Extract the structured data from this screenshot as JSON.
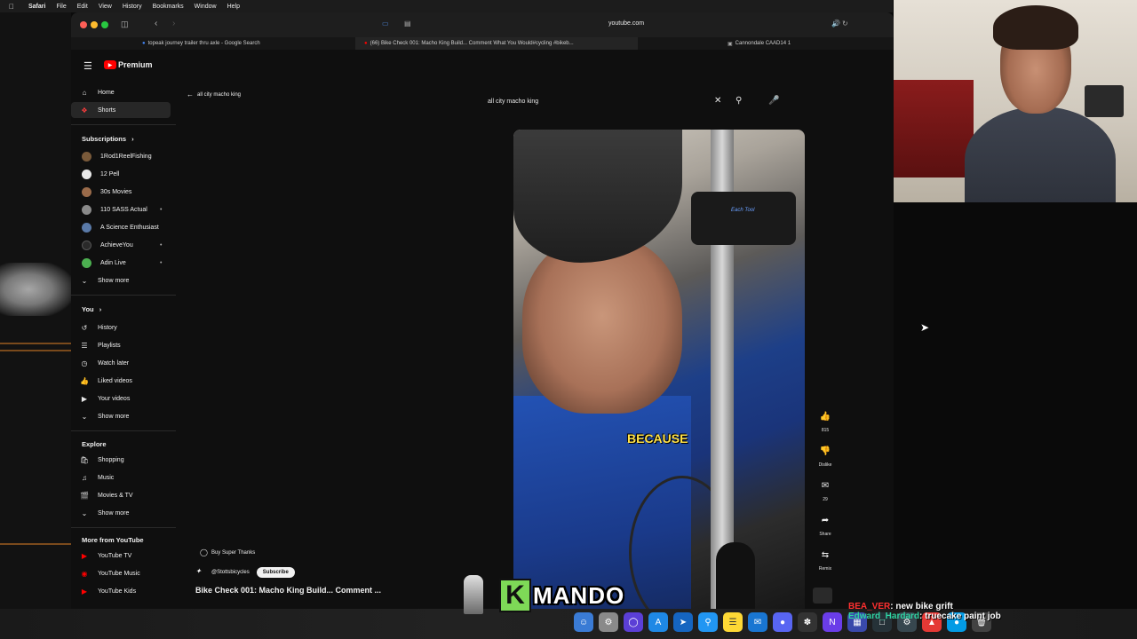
{
  "menubar": {
    "app": "Safari",
    "items": [
      "File",
      "Edit",
      "View",
      "History",
      "Bookmarks",
      "Window",
      "Help"
    ]
  },
  "browser": {
    "url": "youtube.com",
    "tabs": [
      {
        "title": "topeak journey trailer thru axle - Google Search",
        "active": false
      },
      {
        "title": "(66) Bike Check 001: Macho King Build... Comment What You Would#cycling #bikeb...",
        "active": true
      },
      {
        "title": "Cannondale CAAD14 1",
        "active": false
      }
    ]
  },
  "youtube": {
    "logo": "Premium",
    "search_query": "all city macho king",
    "back_label": "all city macho king",
    "sidebar": {
      "main": [
        {
          "label": "Home",
          "icon": "home-icon",
          "active": false
        },
        {
          "label": "Shorts",
          "icon": "shorts-icon",
          "active": true
        }
      ],
      "subscriptions_heading": "Subscriptions",
      "subscriptions": [
        {
          "label": "1Rod1ReelFishing",
          "color": "#7a5a3a",
          "dot": false
        },
        {
          "label": "12 Pell",
          "color": "#e8e8e8",
          "dot": false
        },
        {
          "label": "30s Movies",
          "color": "#9a6b4a",
          "dot": false
        },
        {
          "label": "110 SASS Actual",
          "color": "#8a8a8a",
          "dot": true
        },
        {
          "label": "A Science Enthusiast",
          "color": "#5a7aa8",
          "dot": false
        },
        {
          "label": "AchieveYou",
          "color": "#2a2a2a",
          "dot": true
        },
        {
          "label": "Adin Live",
          "color": "#4caf50",
          "dot": true
        }
      ],
      "subs_show_more": "Show more",
      "you_heading": "You",
      "you_items": [
        {
          "label": "History",
          "icon": "history-icon"
        },
        {
          "label": "Playlists",
          "icon": "playlists-icon"
        },
        {
          "label": "Watch later",
          "icon": "watch-later-icon"
        },
        {
          "label": "Liked videos",
          "icon": "liked-icon"
        },
        {
          "label": "Your videos",
          "icon": "your-videos-icon"
        }
      ],
      "you_show_more": "Show more",
      "explore_heading": "Explore",
      "explore_items": [
        {
          "label": "Shopping",
          "icon": "shopping-icon"
        },
        {
          "label": "Music",
          "icon": "music-icon"
        },
        {
          "label": "Movies & TV",
          "icon": "movies-icon"
        }
      ],
      "explore_show_more": "Show more",
      "more_heading": "More from YouTube",
      "more_items": [
        {
          "label": "YouTube TV"
        },
        {
          "label": "YouTube Music"
        },
        {
          "label": "YouTube Kids"
        }
      ]
    },
    "short": {
      "caption": "BECAUSE",
      "clamp_label": "Each Tool",
      "likes": "815",
      "dislike_label": "Dislike",
      "comments": "29",
      "share_label": "Share",
      "remix_label": "Remix",
      "super_thanks": "Buy Super Thanks",
      "channel": "@Stottsbicycles",
      "subscribe": "Subscribe",
      "title": "Bike Check 001: Macho King Build... Comment ..."
    }
  },
  "overlay": {
    "brand_k": "K",
    "brand_rest": "MANDO",
    "chat": [
      {
        "user": "BEA_VER",
        "message": ": new bike grift"
      },
      {
        "user": "Edward_Hardard",
        "message": ": truecake paint job"
      }
    ]
  },
  "colors": {
    "yt_red": "#ff0000",
    "accent_yellow": "#ffe24a",
    "kmando_green": "#7ed957"
  }
}
